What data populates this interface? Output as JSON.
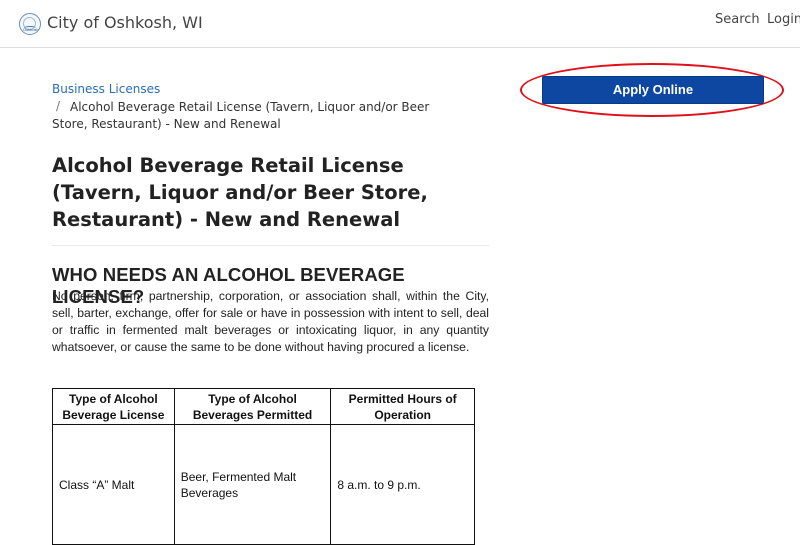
{
  "header": {
    "logo_text": "Oshkosh",
    "site_title": "City of Oshkosh, WI",
    "nav": {
      "search": "Search",
      "login": "Login"
    }
  },
  "breadcrumb": {
    "parent": "Business Licenses",
    "separator": "/",
    "current": "Alcohol Beverage Retail License (Tavern, Liquor and/or Beer Store, Restaurant) - New and Renewal"
  },
  "apply_button": {
    "label": "Apply Online",
    "color": "#0d47a1",
    "highlight_color": "#e0101a"
  },
  "page_title": "Alcohol Beverage Retail License (Tavern, Liquor and/or Beer Store, Restaurant) - New and Renewal",
  "section": {
    "heading": "WHO NEEDS AN ALCOHOL BEVERAGE LICENSE?",
    "body": "No person, firm, partnership, corporation, or association shall, within the City, sell, barter, exchange, offer for sale or have in possession with intent to sell, deal or traffic in fermented malt beverages or intoxicating liquor, in any quantity whatsoever, or cause the same to be done without having procured a license."
  },
  "table": {
    "headers": [
      "Type of Alcohol Beverage License",
      "Type of Alcohol Beverages Permitted",
      "Permitted Hours of Operation"
    ],
    "rows": [
      [
        "Class “A” Malt",
        "Beer, Fermented Malt Beverages",
        "8 a.m. to 9 p.m."
      ]
    ]
  }
}
